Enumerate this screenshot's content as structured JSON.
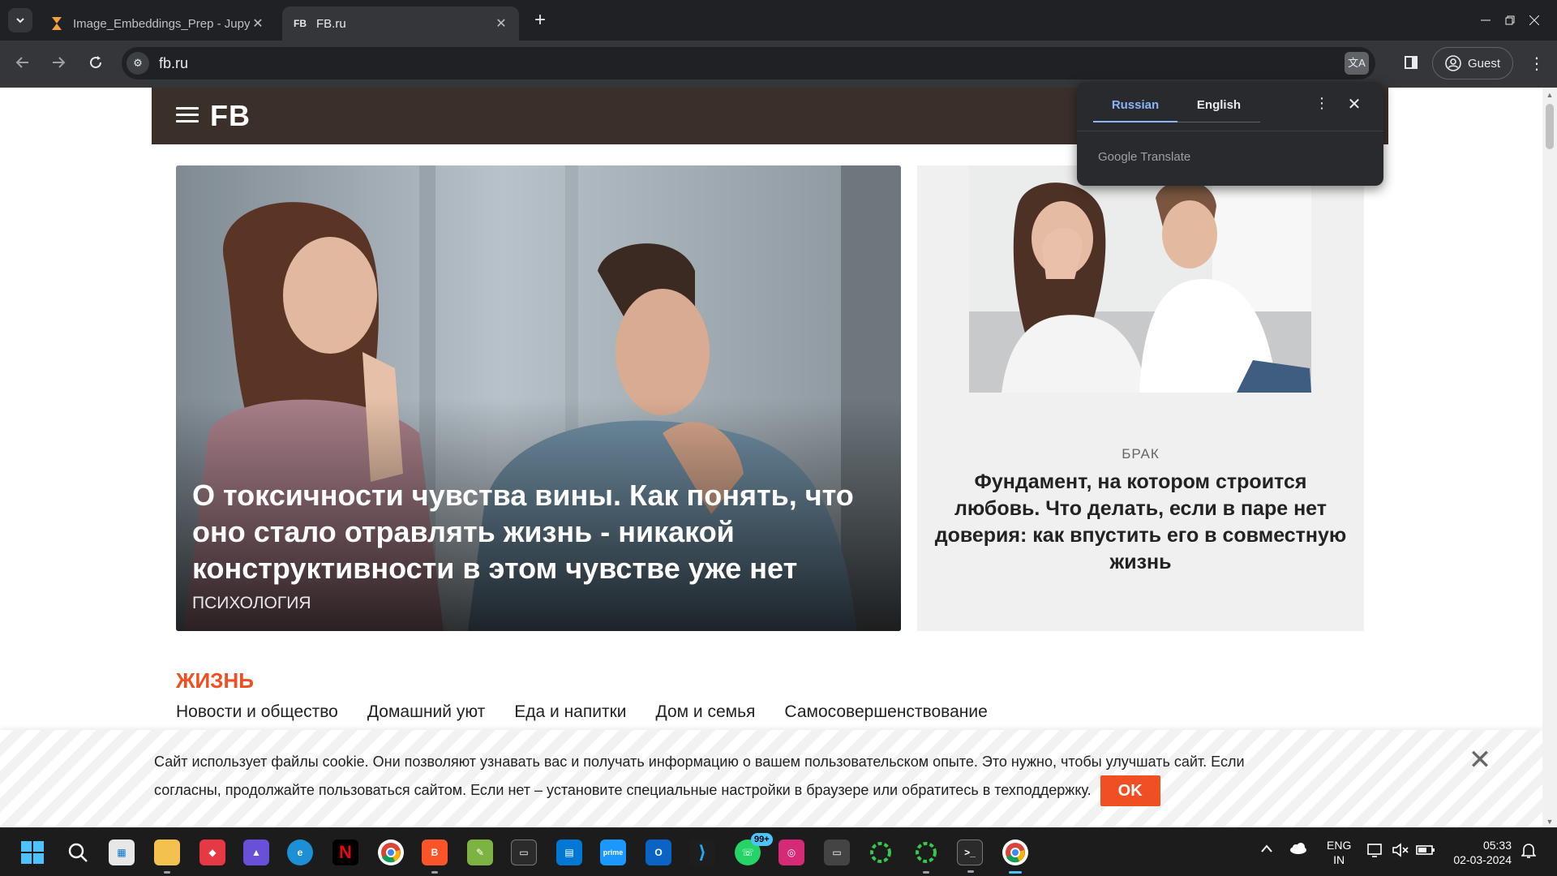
{
  "browser": {
    "tabs": [
      {
        "title": "Image_Embeddings_Prep - Jupy",
        "favicon": "hourglass-icon",
        "active": false
      },
      {
        "title": "FB.ru",
        "favicon": "FB",
        "active": true
      }
    ],
    "new_tab": "+",
    "url": "fb.ru",
    "profile_label": "Guest"
  },
  "translate_popup": {
    "source_lang": "Russian",
    "target_lang": "English",
    "brand": "Google Translate"
  },
  "site": {
    "logo": "FB",
    "hero": {
      "title": "О токсичности чувства вины. Как понять, что оно стало отравлять жизнь - никакой конструктивности в этом чувстве уже нет",
      "category": "ПСИХОЛОГИЯ"
    },
    "card": {
      "category": "БРАК",
      "title": "Фундамент, на котором строится любовь. Что делать, если в паре нет доверия: как впустить его в совместную жизнь"
    },
    "section": {
      "title": "ЖИЗНЬ",
      "links": [
        "Новости и общество",
        "Домашний уют",
        "Еда и напитки",
        "Дом и семья",
        "Самосовершенствование"
      ]
    },
    "cookie": {
      "text": "Сайт использует файлы cookie. Они позволяют узнавать вас и получать информацию о вашем пользовательском опыте. Это нужно, чтобы улучшать сайт. Если согласны, продолжайте пользоваться сайтом. Если нет – установите специальные настройки в браузере или обратитесь в техподдержку.",
      "ok_label": "OK"
    },
    "colors": {
      "header_bg": "#3b3029",
      "accent": "#f04e23"
    }
  },
  "taskbar": {
    "whatsapp_badge": "99+",
    "lang_line1": "ENG",
    "lang_line2": "IN",
    "time": "05:33",
    "date": "02-03-2024"
  }
}
